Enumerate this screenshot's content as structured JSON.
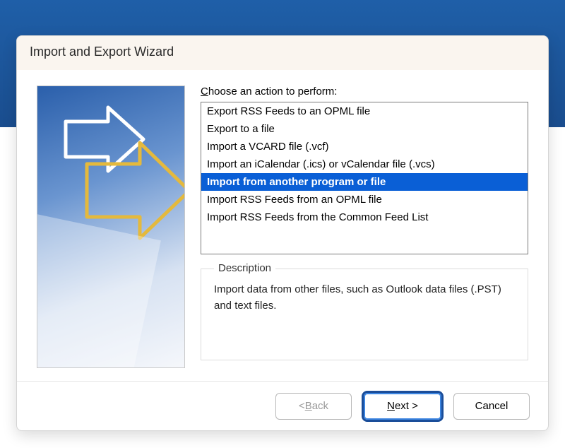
{
  "dialog": {
    "title": "Import and Export Wizard",
    "choose_label_pre": "C",
    "choose_label_post": "hoose an action to perform:"
  },
  "actions": [
    {
      "label": "Export RSS Feeds to an OPML file",
      "selected": false
    },
    {
      "label": "Export to a file",
      "selected": false
    },
    {
      "label": "Import a VCARD file (.vcf)",
      "selected": false
    },
    {
      "label": "Import an iCalendar (.ics) or vCalendar file (.vcs)",
      "selected": false
    },
    {
      "label": "Import from another program or file",
      "selected": true
    },
    {
      "label": "Import RSS Feeds from an OPML file",
      "selected": false
    },
    {
      "label": "Import RSS Feeds from the Common Feed List",
      "selected": false
    }
  ],
  "description": {
    "heading": "Description",
    "text": "Import data from other files, such as Outlook data files (.PST) and text files."
  },
  "buttons": {
    "back_pre": "< ",
    "back_ul": "B",
    "back_post": "ack",
    "next_ul": "N",
    "next_post": "ext >",
    "cancel": "Cancel"
  }
}
